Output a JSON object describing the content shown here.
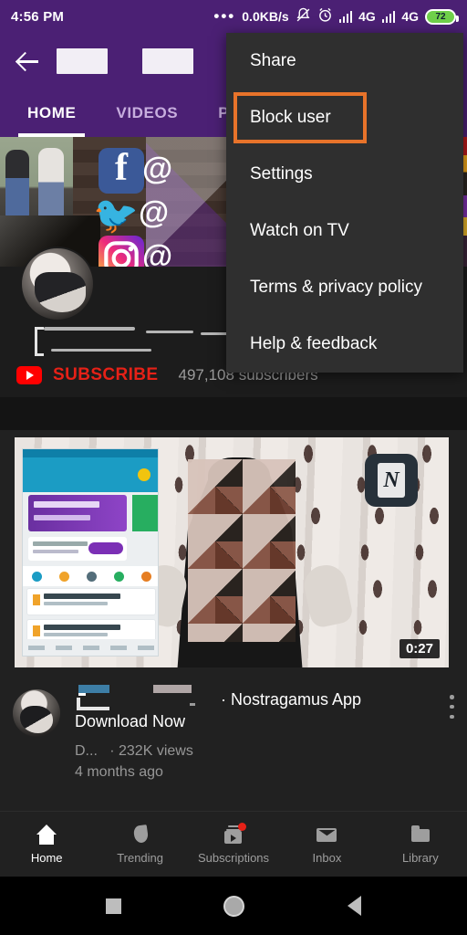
{
  "status_bar": {
    "time": "4:56 PM",
    "dots": "•••",
    "network_speed": "0.0KB/s",
    "bell_icon": "bell-muted-icon",
    "alarm_icon": "alarm-clock-icon",
    "sim1_label": "4G",
    "sim2_label": "4G",
    "battery_level": "72",
    "background_color": "#4b2074"
  },
  "channel_header": {
    "back_icon": "back-arrow-icon",
    "title_redacted": "",
    "overflow_icon": "overflow-menu-icon",
    "tabs": [
      {
        "label": "HOME",
        "active": true
      },
      {
        "label": "VIDEOS",
        "active": false
      },
      {
        "label": "P",
        "active": false
      }
    ],
    "accent_color": "#4b2074"
  },
  "banner": {
    "social_icons": [
      "facebook-icon",
      "twitter-icon",
      "instagram-icon"
    ],
    "handle_symbol": "@"
  },
  "channel_info": {
    "name_redacted": "",
    "subscribe_label": "SUBSCRIBE",
    "subscriber_count": "497,108 subscribers",
    "subscribe_color": "#e62117"
  },
  "overflow_menu": {
    "background_color": "#2f2f2f",
    "highlight_color": "#e8732a",
    "items": [
      {
        "label": "Share",
        "highlighted": false
      },
      {
        "label": "Block user",
        "highlighted": true
      },
      {
        "label": "Settings",
        "highlighted": false
      },
      {
        "label": "Watch on TV",
        "highlighted": false
      },
      {
        "label": "Terms & privacy policy",
        "highlighted": false
      },
      {
        "label": "Help & feedback",
        "highlighted": false
      }
    ]
  },
  "video_card": {
    "duration": "0:27",
    "app_badge_letter": "N",
    "title": "· Nostragamus App Download Now",
    "channel": "D...",
    "views": "· 232K views",
    "upload_age": "4 months ago",
    "overflow_icon": "overflow-menu-icon"
  },
  "bottom_nav": {
    "items": [
      {
        "label": "Home",
        "icon": "home-icon",
        "active": true,
        "badge": false
      },
      {
        "label": "Trending",
        "icon": "flame-icon",
        "active": false,
        "badge": false
      },
      {
        "label": "Subscriptions",
        "icon": "subscriptions-icon",
        "active": false,
        "badge": true
      },
      {
        "label": "Inbox",
        "icon": "envelope-icon",
        "active": false,
        "badge": false
      },
      {
        "label": "Library",
        "icon": "folder-icon",
        "active": false,
        "badge": false
      }
    ]
  },
  "android_nav": {
    "recent_icon": "recents-square-icon",
    "home_icon": "home-circle-icon",
    "back_icon": "back-triangle-icon"
  }
}
